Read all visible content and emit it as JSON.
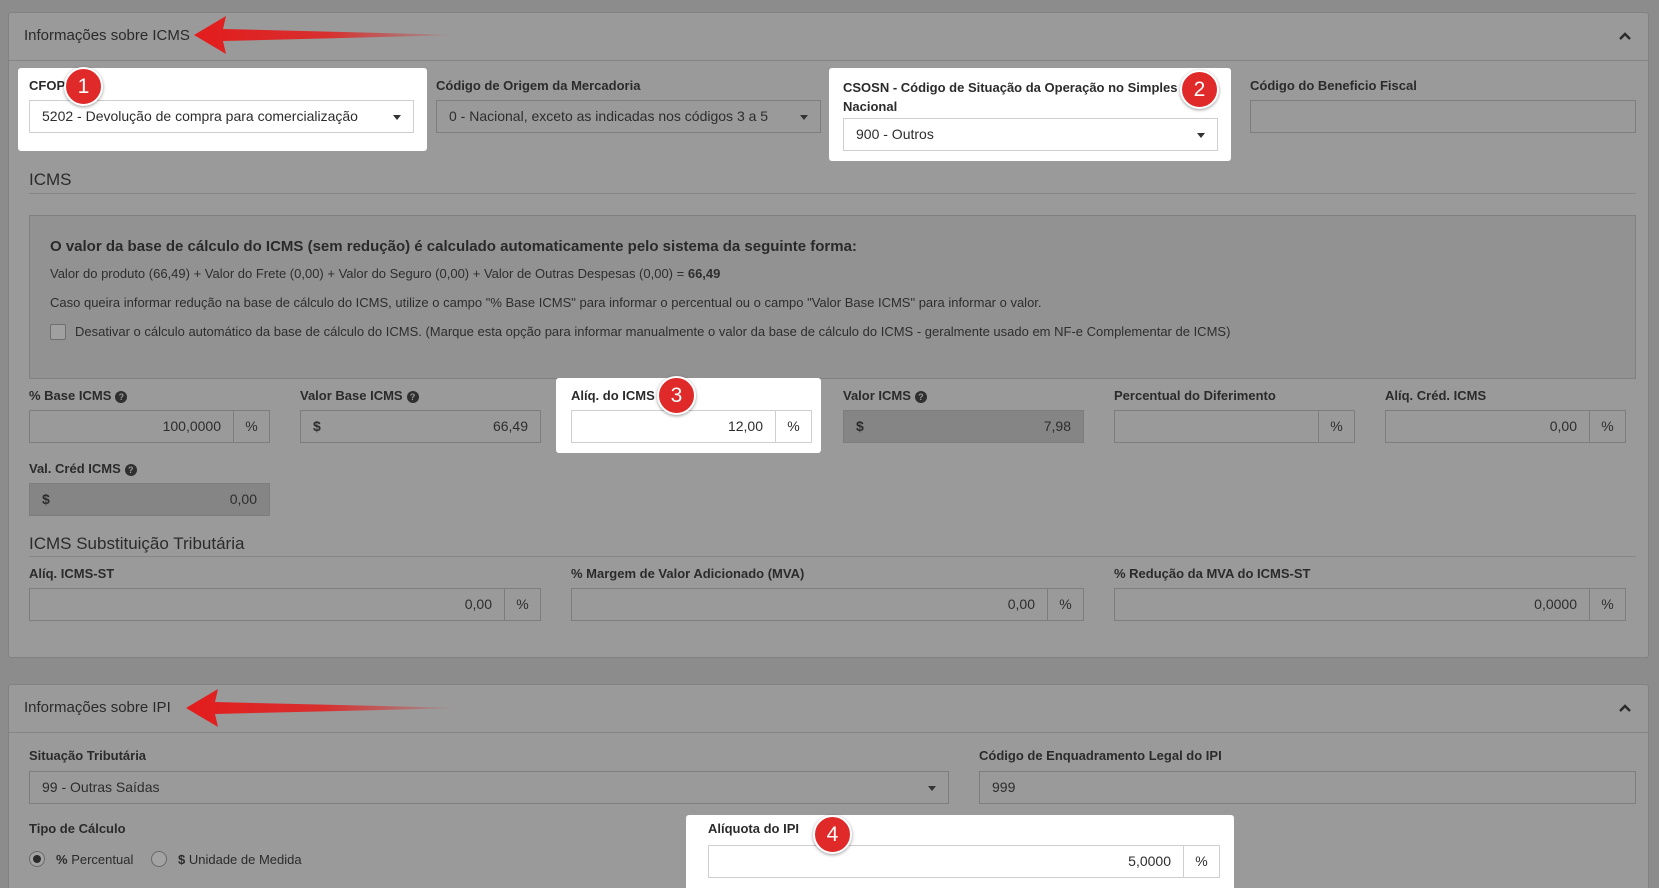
{
  "icms_panel": {
    "title": "Informações sobre ICMS",
    "cfop": {
      "label": "CFOP",
      "value": "5202 - Devolução de compra para comercialização"
    },
    "origem": {
      "label": "Código de Origem da Mercadoria",
      "value": "0 - Nacional, exceto as indicadas nos códigos 3 a 5"
    },
    "csosn": {
      "label": "CSOSN - Código de Situação da Operação no Simples Nacional",
      "value": "900 - Outros"
    },
    "beneficio": {
      "label": "Código do Beneficio Fiscal",
      "value": ""
    },
    "icms_section": "ICMS",
    "info": {
      "heading": "O valor da base de cálculo do ICMS (sem redução) é calculado automaticamente pelo sistema da seguinte forma:",
      "formula": "Valor do produto (66,49) + Valor do Frete (0,00) + Valor do Seguro (0,00) + Valor de Outras Despesas (0,00) = ",
      "formula_result": "66,49",
      "reducao": "Caso queira informar redução na base de cálculo do ICMS, utilize o campo \"% Base ICMS\" para informar o percentual ou o campo \"Valor Base ICMS\" para informar o valor.",
      "checkbox": "Desativar o cálculo automático da base de cálculo do ICMS. (Marque esta opção para informar manualmente o valor da base de cálculo do ICMS - geralmente usado em NF-e Complementar de ICMS)"
    },
    "base_pct": {
      "label": "% Base ICMS",
      "value": "100,0000",
      "addon": "%"
    },
    "valor_base": {
      "label": "Valor Base ICMS",
      "value": "66,49",
      "addon": "$"
    },
    "aliq_icms": {
      "label": "Alíq. do ICMS",
      "value": "12,00",
      "addon": "%"
    },
    "valor_icms": {
      "label": "Valor ICMS",
      "value": "7,98",
      "addon": "$"
    },
    "diferimento": {
      "label": "Percentual do Diferimento",
      "value": "",
      "addon": "%"
    },
    "aliq_cred": {
      "label": "Alíq. Créd. ICMS",
      "value": "0,00",
      "addon": "%"
    },
    "val_cred": {
      "label": "Val. Créd ICMS",
      "value": "0,00",
      "addon": "$"
    },
    "st_section": "ICMS Substituição Tributária",
    "aliq_st": {
      "label": "Alíq. ICMS-ST",
      "value": "0,00",
      "addon": "%"
    },
    "mva": {
      "label": "% Margem de Valor Adicionado (MVA)",
      "value": "0,00",
      "addon": "%"
    },
    "reducao_mva": {
      "label": "% Redução da MVA do ICMS-ST",
      "value": "0,0000",
      "addon": "%"
    }
  },
  "ipi_panel": {
    "title": "Informações sobre IPI",
    "situacao": {
      "label": "Situação Tributária",
      "value": "99 - Outras Saídas"
    },
    "enquadramento": {
      "label": "Código de Enquadramento Legal do IPI",
      "value": "999"
    },
    "tipo_calculo": {
      "label": "Tipo de Cálculo",
      "option_pct_symbol": "%",
      "option_pct": "Percentual",
      "option_un_symbol": "$",
      "option_un": "Unidade de Medida",
      "selected": "Percentual"
    },
    "aliquota": {
      "label": "Alíquota do IPI",
      "value": "5,0000",
      "addon": "%"
    }
  },
  "badges": [
    "1",
    "2",
    "3",
    "4"
  ],
  "colors": {
    "badge": "#e02a2a",
    "arrow": "#e31c1c",
    "overlay": "#9a9a9a",
    "highlight": "#ffffff"
  }
}
